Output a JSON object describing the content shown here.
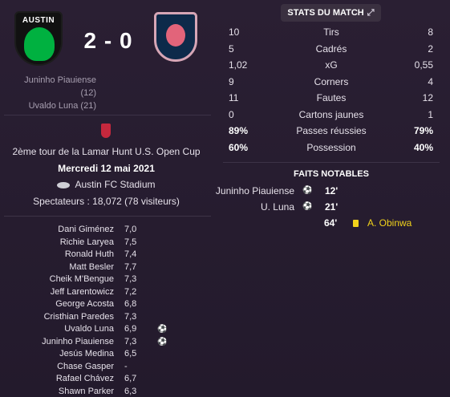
{
  "match": {
    "home_badge_text": "AUSTIN",
    "score": "2 - 0",
    "home_scorers": [
      "Juninho Piauiense (12)",
      "Uvaldo Luna (21)"
    ]
  },
  "info": {
    "competition": "2ème tour de la Lamar Hunt U.S. Open Cup",
    "date": "Mercredi 12 mai 2021",
    "stadium": "Austin FC Stadium",
    "spectators": "Spectateurs : 18,072 (78 visiteurs)"
  },
  "ratings": [
    {
      "name": "Dani Giménez",
      "value": "7,0",
      "goal": false
    },
    {
      "name": "Richie Laryea",
      "value": "7,5",
      "goal": false
    },
    {
      "name": "Ronald Huth",
      "value": "7,4",
      "goal": false
    },
    {
      "name": "Matt Besler",
      "value": "7,7",
      "goal": false
    },
    {
      "name": "Cheik M'Bengue",
      "value": "7,3",
      "goal": false
    },
    {
      "name": "Jeff Larentowicz",
      "value": "7,2",
      "goal": false
    },
    {
      "name": "George Acosta",
      "value": "6,8",
      "goal": false
    },
    {
      "name": "Cristhian Paredes",
      "value": "7,3",
      "goal": false
    },
    {
      "name": "Uvaldo Luna",
      "value": "6,9",
      "goal": true
    },
    {
      "name": "Juninho Piauiense",
      "value": "7,3",
      "goal": true
    },
    {
      "name": "Jesús Medina",
      "value": "6,5",
      "goal": false
    },
    {
      "name": "Chase Gasper",
      "value": "-",
      "goal": false
    },
    {
      "name": "Rafael Chávez",
      "value": "6,7",
      "goal": false
    },
    {
      "name": "Shawn Parker",
      "value": "6,3",
      "goal": false
    }
  ],
  "stats_title": "STATS DU MATCH",
  "stats": [
    {
      "home": "10",
      "label": "Tirs",
      "away": "8",
      "bold": false
    },
    {
      "home": "5",
      "label": "Cadrés",
      "away": "2",
      "bold": false
    },
    {
      "home": "1,02",
      "label": "xG",
      "away": "0,55",
      "bold": false
    },
    {
      "home": "9",
      "label": "Corners",
      "away": "4",
      "bold": false
    },
    {
      "home": "11",
      "label": "Fautes",
      "away": "12",
      "bold": false
    },
    {
      "home": "0",
      "label": "Cartons jaunes",
      "away": "1",
      "bold": false
    },
    {
      "home": "89%",
      "label": "Passes réussies",
      "away": "79%",
      "bold": true
    },
    {
      "home": "60%",
      "label": "Possession",
      "away": "40%",
      "bold": true
    }
  ],
  "notable_title": "FAITS NOTABLES",
  "events": {
    "goals": [
      {
        "player": "Juninho Piauiense",
        "minute": "12'"
      },
      {
        "player": "U. Luna",
        "minute": "21'"
      }
    ],
    "cards": [
      {
        "player": "A. Obinwa",
        "minute": "64'"
      }
    ]
  },
  "icons": {
    "goal": "⚽",
    "expand": "⤢"
  },
  "colors": {
    "background": "#2a1f33",
    "home_green": "#00b140",
    "yellow_card": "#f1d21b"
  }
}
